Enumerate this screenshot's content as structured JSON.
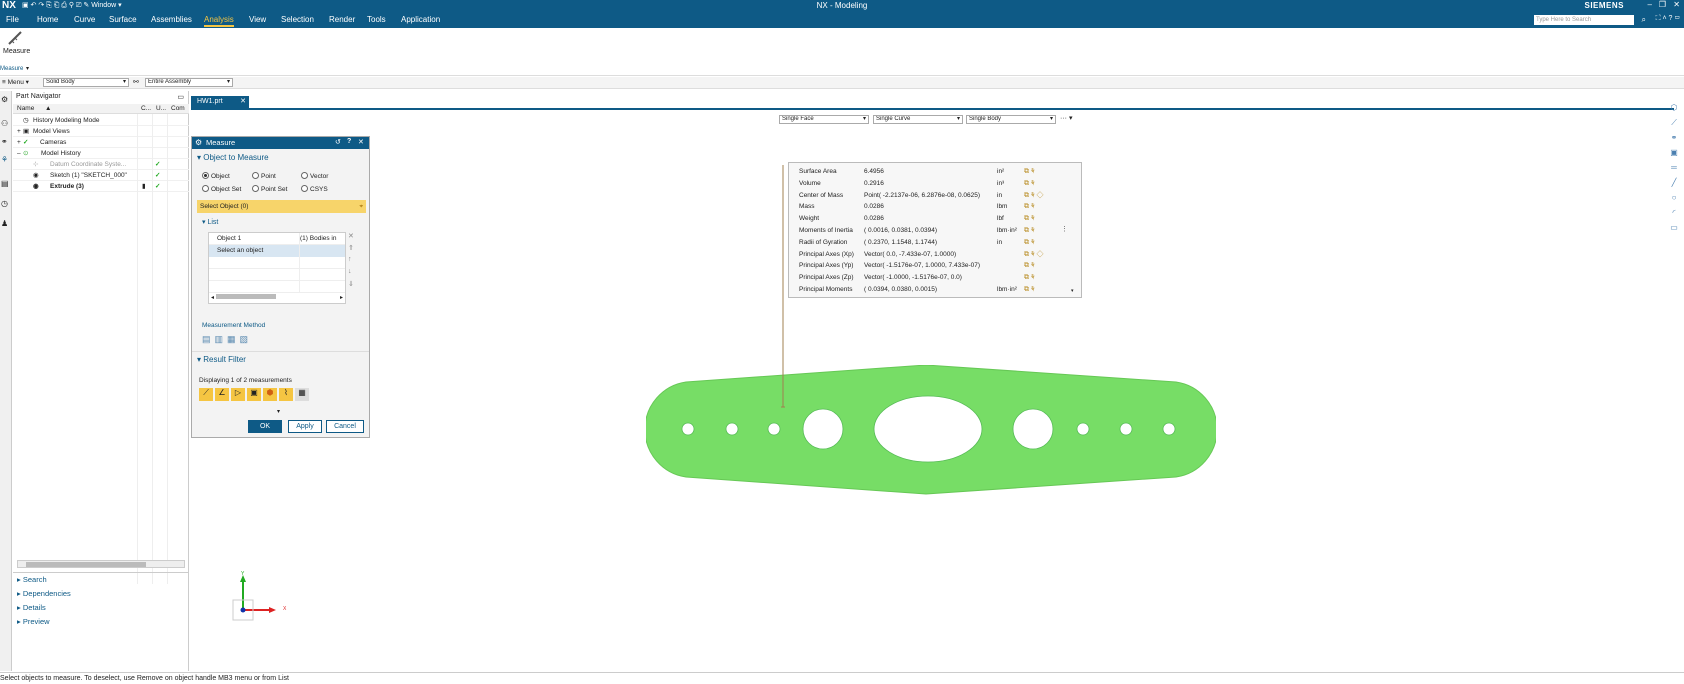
{
  "titlebar": {
    "logo": "NX",
    "title": "NX - Modeling",
    "brand": "SIEMENS",
    "window_menu": "Window"
  },
  "menubar": {
    "items": [
      "File",
      "Home",
      "Curve",
      "Surface",
      "Assemblies",
      "Analysis",
      "View",
      "Selection",
      "Render",
      "Tools",
      "Application"
    ],
    "active": "Analysis",
    "search_placeholder": "Type Here to Search"
  },
  "ribbon": {
    "measure_label": "Measure",
    "group_label": "Measure"
  },
  "selection_bar": {
    "menu_label": "Menu",
    "filter": "Solid Body",
    "scope": "Entire Assembly"
  },
  "navigator": {
    "title": "Part Navigator",
    "columns": [
      "Name",
      "C...",
      "U...",
      "Com"
    ],
    "rows": [
      {
        "label": "History Modeling Mode",
        "indent": 1,
        "check": ""
      },
      {
        "label": "Model Views",
        "indent": 1,
        "check": ""
      },
      {
        "label": "Cameras",
        "indent": 1,
        "check": ""
      },
      {
        "label": "Model History",
        "indent": 1,
        "check": ""
      },
      {
        "label": "Datum Coordinate Syste...",
        "indent": 2,
        "check": "✓"
      },
      {
        "label": "Sketch (1) \"SKETCH_000\"",
        "indent": 2,
        "check": "✓"
      },
      {
        "label": "Extrude (3)",
        "indent": 2,
        "check": "✓"
      }
    ],
    "sections": [
      "Search",
      "Dependencies",
      "Details",
      "Preview"
    ]
  },
  "doc_tab": {
    "label": "HW1.prt"
  },
  "graphics_filters": {
    "face": "Single Face",
    "curve": "Single Curve",
    "body": "Single Body"
  },
  "dialog": {
    "title": "Measure",
    "object_section": "Object to Measure",
    "radios": [
      "Object",
      "Point",
      "Vector",
      "Object Set",
      "Point Set",
      "CSYS"
    ],
    "selected_radio": "Object",
    "select_label": "Select Object (0)",
    "list_section": "List",
    "list_rows": [
      {
        "name": "Object 1",
        "value": "(1) Bodies in"
      },
      {
        "name": "Select an object",
        "value": ""
      }
    ],
    "method_label": "Measurement Method",
    "filter_section": "Result Filter",
    "displaying": "Displaying 1 of 2 measurements",
    "ok": "OK",
    "apply": "Apply",
    "cancel": "Cancel"
  },
  "results": [
    {
      "name": "Surface Area",
      "value": "6.4956",
      "unit": "in²"
    },
    {
      "name": "Volume",
      "value": "0.2916",
      "unit": "in³"
    },
    {
      "name": "Center of Mass",
      "value": "Point( -2.2137e-06, 6.2876e-08, 0.0625)",
      "unit": "in"
    },
    {
      "name": "Mass",
      "value": "0.0286",
      "unit": "lbm"
    },
    {
      "name": "Weight",
      "value": "0.0286",
      "unit": "lbf"
    },
    {
      "name": "Moments of Inertia",
      "value": "( 0.0016, 0.0381, 0.0394)",
      "unit": "lbm·in²"
    },
    {
      "name": "Radii of Gyration",
      "value": "( 0.2370, 1.1548, 1.1744)",
      "unit": "in"
    },
    {
      "name": "Principal Axes (Xp)",
      "value": "Vector( 0.0, -7.433e-07, 1.0000)",
      "unit": ""
    },
    {
      "name": "Principal Axes (Yp)",
      "value": "Vector( -1.5176e-07, 1.0000, 7.433e-07)",
      "unit": ""
    },
    {
      "name": "Principal Axes (Zp)",
      "value": "Vector( -1.0000, -1.5176e-07, 0.0)",
      "unit": ""
    },
    {
      "name": "Principal Moments",
      "value": "( 0.0394, 0.0380, 0.0015)",
      "unit": "lbm·in²"
    }
  ],
  "triad": {
    "x": "X",
    "y": "Y"
  },
  "status": "Select objects to measure. To deselect, use Remove on object handle MB3 menu or from List",
  "colors": {
    "accent": "#0e5a86",
    "part": "#77dd66",
    "active_menu": "#f5c542"
  }
}
